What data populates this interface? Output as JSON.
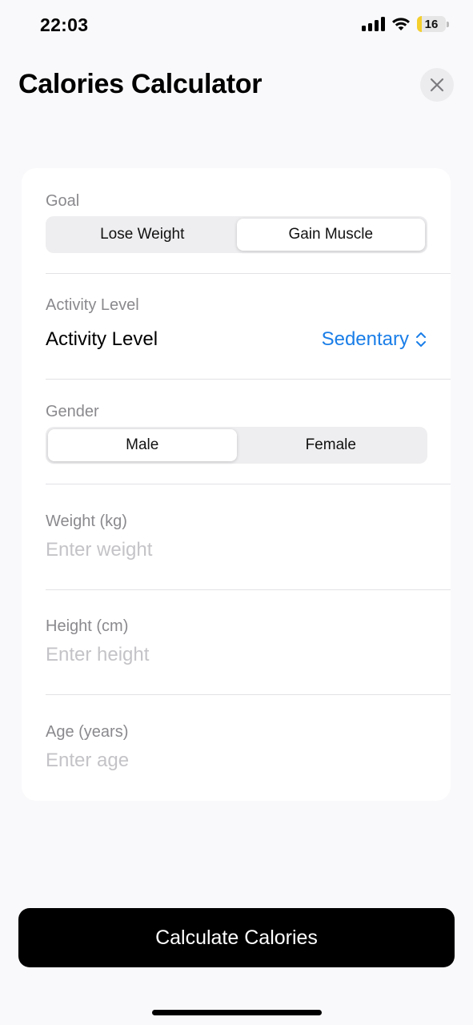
{
  "status_bar": {
    "time": "22:03",
    "battery_percent": "16",
    "battery_level": 0.16,
    "signal_icon": "cellular-signal-icon",
    "wifi_icon": "wifi-icon"
  },
  "header": {
    "title": "Calories Calculator",
    "close_icon": "close-icon"
  },
  "form": {
    "goal": {
      "label": "Goal",
      "options": [
        "Lose Weight",
        "Gain Muscle"
      ],
      "selected": "Gain Muscle"
    },
    "activity": {
      "label": "Activity Level",
      "row_title": "Activity Level",
      "value": "Sedentary",
      "picker_icon": "chevron-up-down-icon"
    },
    "gender": {
      "label": "Gender",
      "options": [
        "Male",
        "Female"
      ],
      "selected": "Male"
    },
    "weight": {
      "label": "Weight (kg)",
      "placeholder": "Enter weight"
    },
    "height": {
      "label": "Height (cm)",
      "placeholder": "Enter height"
    },
    "age": {
      "label": "Age (years)",
      "placeholder": "Enter age"
    }
  },
  "actions": {
    "calculate_label": "Calculate Calories"
  },
  "colors": {
    "accent": "#1a7ee8",
    "button_bg": "#000000",
    "battery_fill": "#f4cf2d"
  }
}
